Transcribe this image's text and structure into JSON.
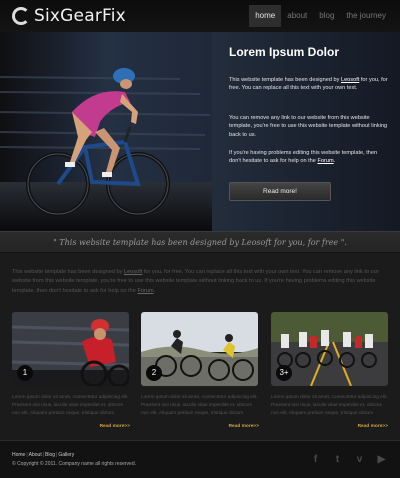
{
  "brand": {
    "name": "SixGearFix"
  },
  "nav": [
    {
      "label": "home",
      "active": true
    },
    {
      "label": "about",
      "active": false
    },
    {
      "label": "blog",
      "active": false
    },
    {
      "label": "the journey",
      "active": false
    }
  ],
  "hero": {
    "title": "Lorem Ipsum Dolor",
    "p1_pre": "This website template has been designed by ",
    "p1_link": "Leosoft",
    "p1_post": " for you, for free. You can replace all this text with your own text.",
    "p2": "You can remove any link to our website from this website template, you're free to use this website template without linking back to us.",
    "p3_pre": "If you're having problems editing this website template, then don't hesitate to ask for help on the ",
    "p3_link": "Forum",
    "p3_post": ".",
    "button": "Read more!"
  },
  "quote": "\" This website template has been designed by Leosoft for you, for free \".",
  "intro": {
    "pre": "This website template has been designed by ",
    "link1": "Leosoft",
    "mid": " for you, for free. You can replace all this text with your own text. You can remove any link to our website from this website template, you're free to use this website template without linking back to us. If you're having problems editing this website template, then don't hesitate to ask for help on the ",
    "link2": "Forum",
    "post": "."
  },
  "columns": [
    {
      "badge": "1",
      "text": "Lorem ipsum dolor sit amet, consectetur adipiscing elit. Praesent nisi risus, iaculis vitae imperdiet et, ultrices non elit. Aliquam pretium neque, tristique dictum",
      "more": "Read more>>"
    },
    {
      "badge": "2",
      "text": "Lorem ipsum dolor sit amet, consectetur adipiscing elit. Praesent nisi risus, iaculis vitae imperdiet et, ultrices non elit. Aliquam pretium neque, tristique dictum",
      "more": "Read more>>"
    },
    {
      "badge": "3+",
      "text": "Lorem ipsum dolor sit amet, consectetur adipiscing elit. Praesent nisi risus, iaculis vitae imperdiet et, ultrices non elit. Aliquam pretium neque, tristique dictum",
      "more": "Read more>>"
    }
  ],
  "footer": {
    "links": [
      "Home",
      "About",
      "Blog",
      "Gallery"
    ],
    "copyright": "© Copyright © 2011. Company name all rights reserved."
  },
  "social": [
    {
      "icon": "facebook-icon",
      "glyph": "f"
    },
    {
      "icon": "twitter-icon",
      "glyph": "t"
    },
    {
      "icon": "vimeo-icon",
      "glyph": "v"
    },
    {
      "icon": "youtube-icon",
      "glyph": "▶"
    }
  ],
  "colors": {
    "accent": "#d4a43c",
    "background": "#1b1b1c",
    "header": "#0c0c0c"
  }
}
